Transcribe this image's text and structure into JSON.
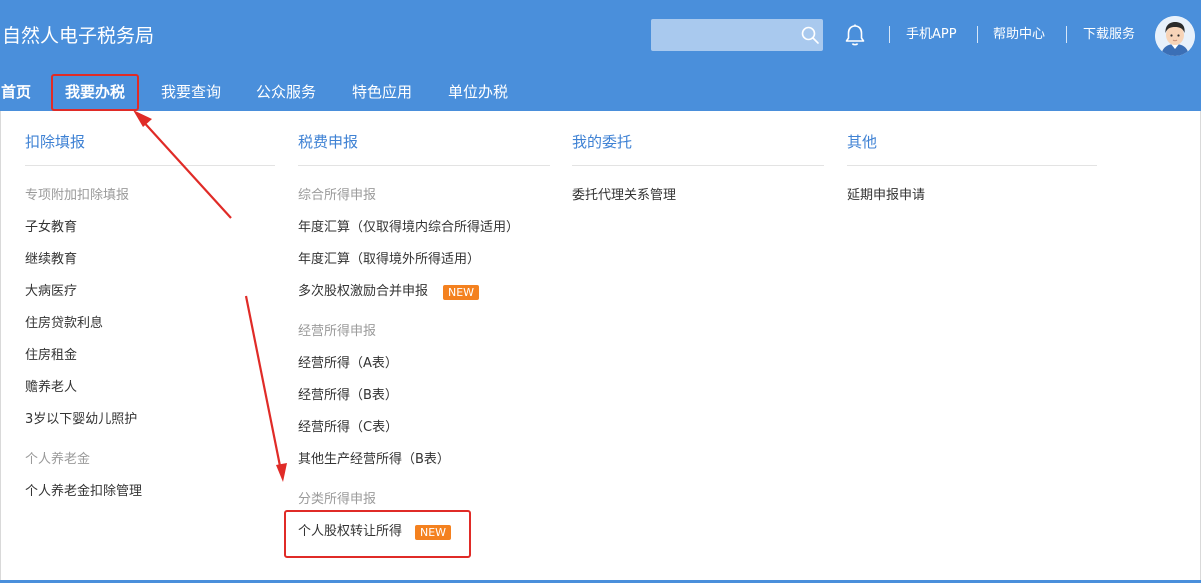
{
  "header": {
    "site_title": "自然人电子税务局",
    "search_placeholder": "",
    "links": [
      "手机APP",
      "帮助中心",
      "下载服务"
    ]
  },
  "nav": {
    "items": [
      "首页",
      "我要办税",
      "我要查询",
      "公众服务",
      "特色应用",
      "单位办税"
    ]
  },
  "columns": {
    "deduction": {
      "title": "扣除填报",
      "sub1": "专项附加扣除填报",
      "items1": [
        "子女教育",
        "继续教育",
        "大病医疗",
        "住房贷款利息",
        "住房租金",
        "赡养老人",
        "3岁以下婴幼儿照护"
      ],
      "sub2": "个人养老金",
      "items2": [
        "个人养老金扣除管理"
      ]
    },
    "declaration": {
      "title": "税费申报",
      "sub1": "综合所得申报",
      "items1": [
        "年度汇算（仅取得境内综合所得适用）",
        "年度汇算（取得境外所得适用）",
        "多次股权激励合并申报"
      ],
      "sub2": "经营所得申报",
      "items2": [
        "经营所得（A表）",
        "经营所得（B表）",
        "经营所得（C表）",
        "其他生产经营所得（B表）"
      ],
      "sub3": "分类所得申报",
      "items3": [
        "个人股权转让所得"
      ]
    },
    "entrust": {
      "title": "我的委托",
      "items": [
        "委托代理关系管理"
      ]
    },
    "other": {
      "title": "其他",
      "items": [
        "延期申报申请"
      ]
    }
  },
  "badge_text": "NEW",
  "colors": {
    "header_bg": "#4a8fdb",
    "column_title": "#3f82d4",
    "badge_bg": "#f4811f",
    "annotation_red": "#e02b27"
  },
  "icons": [
    "search-icon",
    "bell-icon",
    "avatar"
  ]
}
